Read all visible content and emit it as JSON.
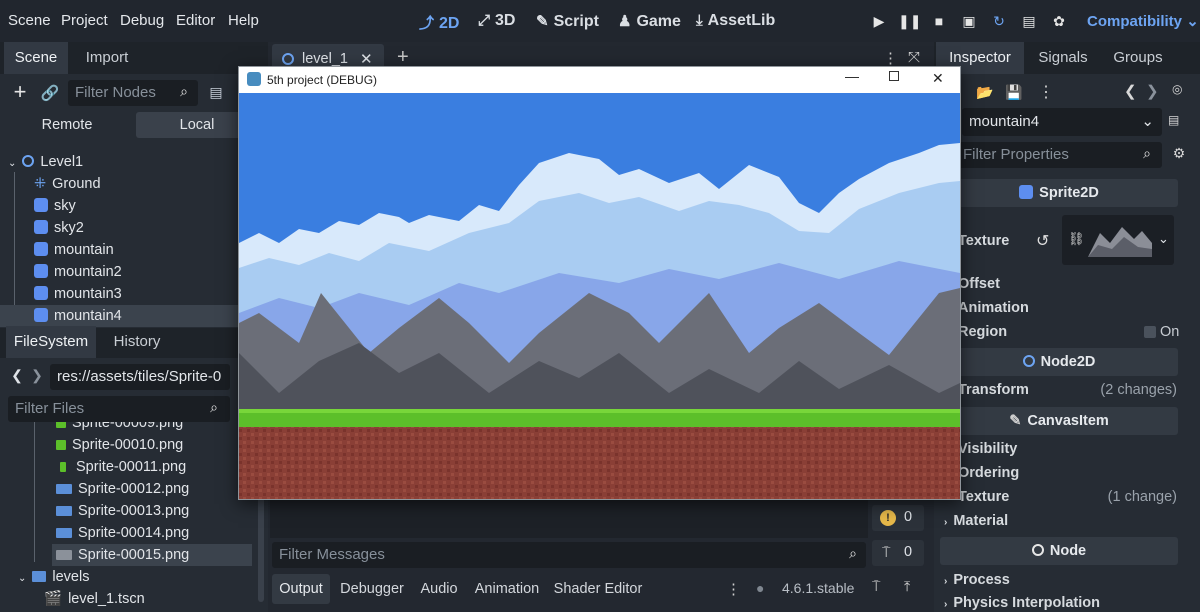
{
  "menu": [
    "Scene",
    "Project",
    "Debug",
    "Editor",
    "Help"
  ],
  "workspaces": [
    {
      "label": "2D",
      "icon": "2d-icon",
      "active": true
    },
    {
      "label": "3D",
      "icon": "3d-icon"
    },
    {
      "label": "Script",
      "icon": "script-icon"
    },
    {
      "label": "Game",
      "icon": "game-icon"
    },
    {
      "label": "AssetLib",
      "icon": "assetlib-icon"
    }
  ],
  "renderer": "Compatibility",
  "scene_dock": {
    "tabs": [
      "Scene",
      "Import"
    ],
    "filter_placeholder": "Filter Nodes",
    "remote_label": "Remote",
    "local_label": "Local",
    "nodes": [
      {
        "label": "Level1",
        "type": "root"
      },
      {
        "label": "Ground",
        "type": "tilemap"
      },
      {
        "label": "sky",
        "type": "sprite"
      },
      {
        "label": "sky2",
        "type": "sprite"
      },
      {
        "label": "mountain",
        "type": "sprite"
      },
      {
        "label": "mountain2",
        "type": "sprite"
      },
      {
        "label": "mountain3",
        "type": "sprite"
      },
      {
        "label": "mountain4",
        "type": "sprite",
        "selected": true
      }
    ]
  },
  "filesystem": {
    "tabs": [
      "FileSystem",
      "History"
    ],
    "path": "res://assets/tiles/Sprite-0",
    "filter_placeholder": "Filter Files",
    "files": [
      {
        "label": "Sprite-00009.png",
        "partial": true
      },
      {
        "label": "Sprite-00010.png"
      },
      {
        "label": "Sprite-00011.png"
      },
      {
        "label": "Sprite-00012.png"
      },
      {
        "label": "Sprite-00013.png"
      },
      {
        "label": "Sprite-00014.png"
      },
      {
        "label": "Sprite-00015.png",
        "selected": true
      }
    ],
    "folder": "levels",
    "scene_file": "level_1.tscn"
  },
  "editor_tab": "level_1",
  "game_window": {
    "title": "5th project (DEBUG)",
    "colors": {
      "sky": "#3a7ee0",
      "cloud": "#a9ccf2",
      "cloud_light": "#d8e9fb",
      "mountain": "#6b6e78",
      "mountain_dark": "#4f525b",
      "grass": "#5cbf2a",
      "dirt": "#8a3f36"
    }
  },
  "bottom_panel": {
    "filter_placeholder": "Filter Messages",
    "warnings_count": "0",
    "errors_count": "0",
    "tabs": [
      "Output",
      "Debugger",
      "Audio",
      "Animation",
      "Shader Editor"
    ],
    "version": "4.6.1.stable"
  },
  "inspector": {
    "tabs": [
      "Inspector",
      "Signals",
      "Groups"
    ],
    "node_name": "mountain4",
    "filter_placeholder": "Filter Properties",
    "sections": {
      "sprite2d": "Sprite2D",
      "node2d": "Node2D",
      "canvasitem": "CanvasItem",
      "node": "Node"
    },
    "props": {
      "texture": "Texture",
      "offset": "Offset",
      "animation": "Animation",
      "region": "Region",
      "region_value": "On",
      "transform": "Transform",
      "transform_value": "(2 changes)",
      "visibility": "Visibility",
      "ordering": "Ordering",
      "texture2": "Texture",
      "texture2_value": "(1 change)",
      "material": "Material",
      "process": "Process",
      "physics": "Physics Interpolation"
    }
  }
}
